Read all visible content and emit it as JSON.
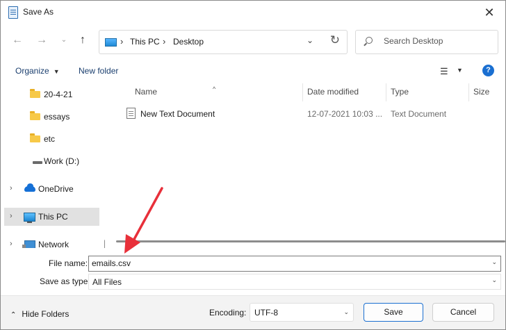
{
  "window": {
    "title": "Save As"
  },
  "nav": {
    "breadcrumbs": [
      "This PC",
      "Desktop"
    ],
    "search_placeholder": "Search Desktop"
  },
  "toolbar": {
    "organize_label": "Organize",
    "new_folder_label": "New folder",
    "help_label": "?"
  },
  "sidebar": {
    "items": [
      {
        "label": "20-4-21",
        "icon": "folder-icon"
      },
      {
        "label": "essays",
        "icon": "folder-icon"
      },
      {
        "label": "etc",
        "icon": "folder-icon"
      },
      {
        "label": "Work (D:)",
        "icon": "drive-icon"
      },
      {
        "label": "OneDrive",
        "icon": "cloud-icon"
      },
      {
        "label": "This PC",
        "icon": "monitor-icon",
        "selected": true
      },
      {
        "label": "Network",
        "icon": "network-icon"
      }
    ]
  },
  "file_list": {
    "columns": [
      "Name",
      "Date modified",
      "Type",
      "Size"
    ],
    "rows": [
      {
        "name": "New Text Document",
        "date": "12-07-2021 10:03 ...",
        "type": "Text Document",
        "size": ""
      }
    ]
  },
  "save_form": {
    "file_name_label": "File name:",
    "file_name_value": "emails.csv",
    "save_type_label": "Save as type:",
    "save_type_value": "All Files"
  },
  "bottom": {
    "hide_folders_label": "Hide Folders",
    "encoding_label": "Encoding:",
    "encoding_value": "UTF-8",
    "save_label": "Save",
    "cancel_label": "Cancel"
  },
  "annotation": {
    "color": "#e8303a"
  }
}
